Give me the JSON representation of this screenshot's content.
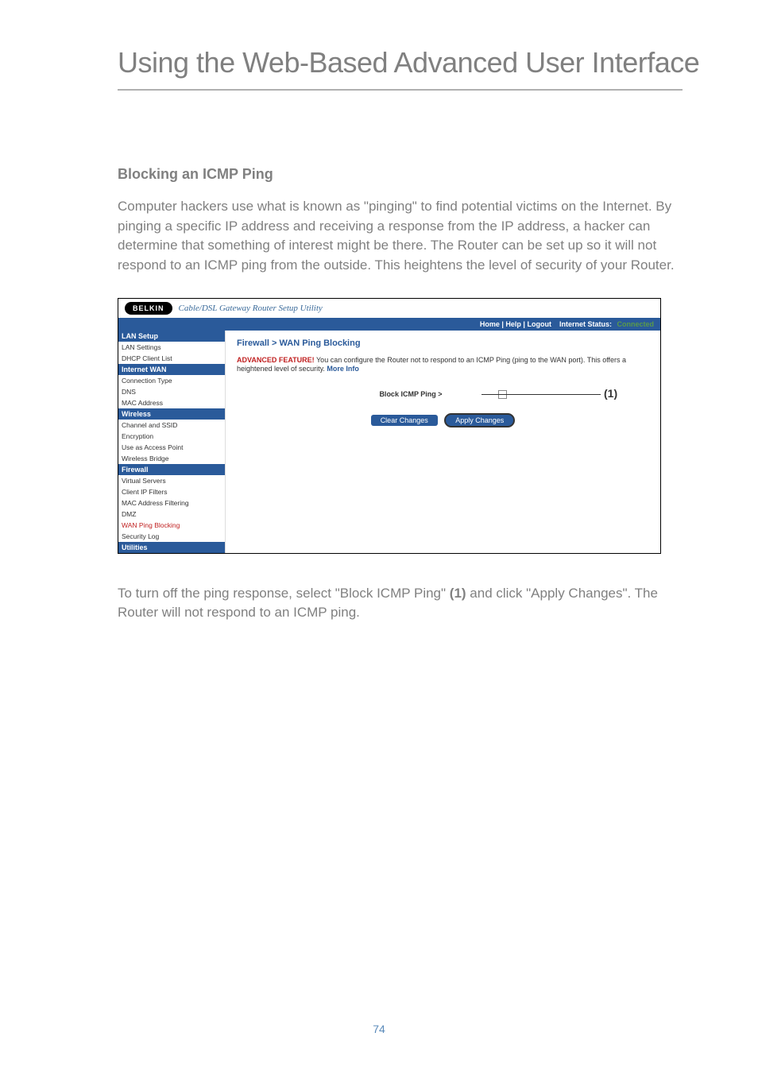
{
  "page": {
    "title": "Using the Web-Based Advanced User Interface",
    "number": "74"
  },
  "section": {
    "heading": "Blocking an ICMP Ping",
    "body": "Computer hackers use what is known as \"pinging\" to find potential victims on the Internet. By pinging a specific IP address and receiving a response from the IP address, a hacker can determine that something of interest might be there. The Router can be set up so it will not respond to an ICMP ping from the outside. This heightens the level of security of your Router.",
    "instruction_pre": "To turn off the ping response, select \"Block ICMP Ping\" ",
    "instruction_bold": "(1)",
    "instruction_post": " and click \"Apply Changes\". The Router will not respond to an ICMP ping."
  },
  "utility": {
    "logo": "BELKIN",
    "subtitle": "Cable/DSL Gateway Router Setup Utility",
    "topbar": {
      "links": "Home | Help | Logout",
      "status_label": "Internet Status:",
      "status_value": "Connected"
    },
    "sidebar": {
      "groups": [
        {
          "header": "LAN Setup",
          "items": [
            "LAN Settings",
            "DHCP Client List"
          ]
        },
        {
          "header": "Internet WAN",
          "items": [
            "Connection Type",
            "DNS",
            "MAC Address"
          ]
        },
        {
          "header": "Wireless",
          "items": [
            "Channel and SSID",
            "Encryption",
            "Use as Access Point",
            "Wireless Bridge"
          ]
        },
        {
          "header": "Firewall",
          "items": [
            "Virtual Servers",
            "Client IP Filters",
            "MAC Address Filtering",
            "DMZ"
          ],
          "red_item": "WAN Ping Blocking",
          "items_after": [
            "Security Log"
          ]
        },
        {
          "header": "Utilities",
          "items": []
        }
      ]
    },
    "main": {
      "title": "Firewall > WAN Ping Blocking",
      "adv_label": "ADVANCED FEATURE!",
      "adv_text": " You can configure the Router not to respond to an ICMP Ping (ping to the WAN port). This offers a heightened level of security. ",
      "more_info": "More Info",
      "block_label": "Block ICMP Ping >",
      "callout": "(1)",
      "clear_btn": "Clear Changes",
      "apply_btn": "Apply Changes"
    }
  }
}
